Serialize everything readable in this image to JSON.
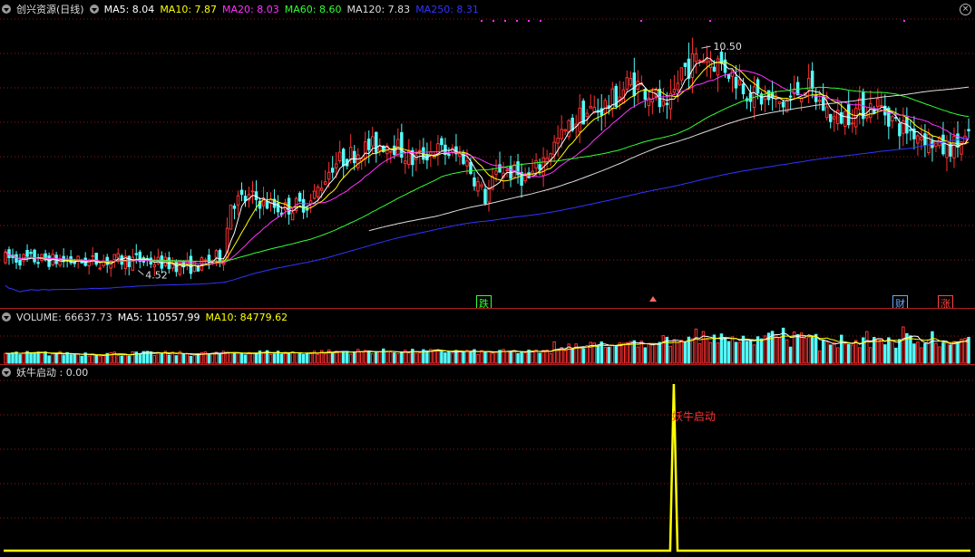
{
  "price_header": {
    "title": "创兴资源(日线)",
    "ma": [
      {
        "label": "MA5: 8.04",
        "color": "#ffffff"
      },
      {
        "label": "MA10: 7.87",
        "color": "#ffff00"
      },
      {
        "label": "MA20: 8.03",
        "color": "#ff33ff"
      },
      {
        "label": "MA60: 8.60",
        "color": "#33ff33"
      },
      {
        "label": "MA120: 7.83",
        "color": "#dddddd"
      },
      {
        "label": "MA250: 8.31",
        "color": "#3333ff"
      }
    ]
  },
  "volume_header": {
    "items": [
      {
        "label": "VOLUME: 66637.73",
        "color": "#dddddd"
      },
      {
        "label": "MA5: 110557.99",
        "color": "#ffffff"
      },
      {
        "label": "MA10: 84779.62",
        "color": "#ffff00"
      }
    ]
  },
  "indicator_header": {
    "items": [
      {
        "label": "妖牛启动 : 0.00",
        "color": "#dddddd"
      }
    ]
  },
  "signals": [
    {
      "text": "跌",
      "x": 532,
      "color": "#33ff33",
      "border": "#33ff33"
    },
    {
      "text": "财",
      "x": 991,
      "color": "#66aaff",
      "border": "#66aaff"
    },
    {
      "text": "涨",
      "x": 1041,
      "color": "#ff4444",
      "border": "#ff4444"
    }
  ],
  "colors": {
    "up": "#ff3232",
    "down": "#54fcfc",
    "grid": "#8b1a1a",
    "indicator_line": "#ffff00",
    "indicator_label": "#ff3232"
  },
  "chart_data": [
    {
      "type": "candlestick",
      "name": "price",
      "title": "创兴资源(日线)",
      "ylim": [
        4.0,
        11.3
      ],
      "annotations": [
        {
          "text": "10.50",
          "value": 10.5
        },
        {
          "text": "4.52",
          "value": 4.52
        }
      ],
      "series": [
        {
          "name": "MA5",
          "color": "#ffffff"
        },
        {
          "name": "MA10",
          "color": "#ffff00"
        },
        {
          "name": "MA20",
          "color": "#ff33ff"
        },
        {
          "name": "MA60",
          "color": "#33ff33"
        },
        {
          "name": "MA120",
          "color": "#dddddd"
        },
        {
          "name": "MA250",
          "color": "#3333ff"
        }
      ]
    },
    {
      "type": "bar",
      "name": "volume",
      "series": [
        {
          "name": "VOLUME",
          "color": "#dddddd"
        },
        {
          "name": "MA5",
          "color": "#ffffff"
        },
        {
          "name": "MA10",
          "color": "#ffff00"
        }
      ]
    },
    {
      "type": "line",
      "name": "妖牛启动",
      "ylim": [
        0,
        1
      ],
      "values": [
        0,
        0,
        0,
        0,
        0,
        0,
        0,
        0,
        0,
        0,
        0,
        0,
        0,
        0,
        0,
        0,
        0,
        0,
        0,
        0,
        0,
        0,
        0,
        0,
        0,
        0,
        0,
        0,
        0,
        0,
        0,
        0,
        0,
        0,
        0,
        0,
        0,
        0,
        0,
        0,
        0,
        0,
        0,
        0,
        0,
        0,
        0,
        0,
        0,
        0,
        0,
        0,
        0,
        0,
        0,
        0,
        0,
        0,
        0,
        0,
        0,
        0,
        0,
        0,
        0,
        0,
        0,
        0,
        0,
        0,
        0,
        0,
        0,
        0,
        0,
        0,
        0,
        0,
        0,
        0,
        0,
        0,
        0,
        0,
        0,
        0,
        0,
        0,
        0,
        0,
        0,
        0,
        0,
        0,
        0,
        0,
        0,
        0,
        0,
        0,
        0,
        0,
        0,
        0,
        0,
        0,
        0,
        0,
        0,
        0,
        0,
        0,
        0,
        0,
        0,
        0,
        0,
        0,
        0,
        0,
        0,
        0,
        0,
        0,
        0,
        0,
        0,
        0,
        0,
        0,
        0,
        0,
        0,
        0,
        0,
        0,
        0,
        0,
        0,
        0,
        0,
        0,
        0,
        0,
        0,
        0,
        0,
        0,
        0,
        0,
        0,
        0,
        0,
        0,
        0,
        0,
        0,
        0,
        0,
        0,
        0,
        0,
        0,
        0,
        0,
        0,
        0,
        0,
        0,
        0,
        0,
        0,
        0,
        0,
        0,
        0,
        0,
        0,
        0,
        0,
        0,
        0,
        0,
        1,
        0,
        0,
        0,
        0,
        0,
        0,
        0,
        0,
        0,
        0,
        0,
        0,
        0,
        0,
        0,
        0,
        0,
        0,
        0,
        0,
        0,
        0,
        0,
        0,
        0,
        0,
        0,
        0,
        0,
        0,
        0,
        0,
        0,
        0,
        0,
        0,
        0,
        0,
        0,
        0,
        0,
        0,
        0,
        0,
        0,
        0,
        0,
        0,
        0,
        0,
        0,
        0,
        0,
        0,
        0,
        0,
        0,
        0,
        0,
        0,
        0,
        0,
        0,
        0,
        0,
        0,
        0,
        0,
        0,
        0,
        0,
        0,
        0,
        0,
        0,
        0,
        0,
        0,
        0,
        0,
        0
      ],
      "annotations": [
        {
          "text": "妖牛启动",
          "index": 183
        }
      ]
    }
  ]
}
